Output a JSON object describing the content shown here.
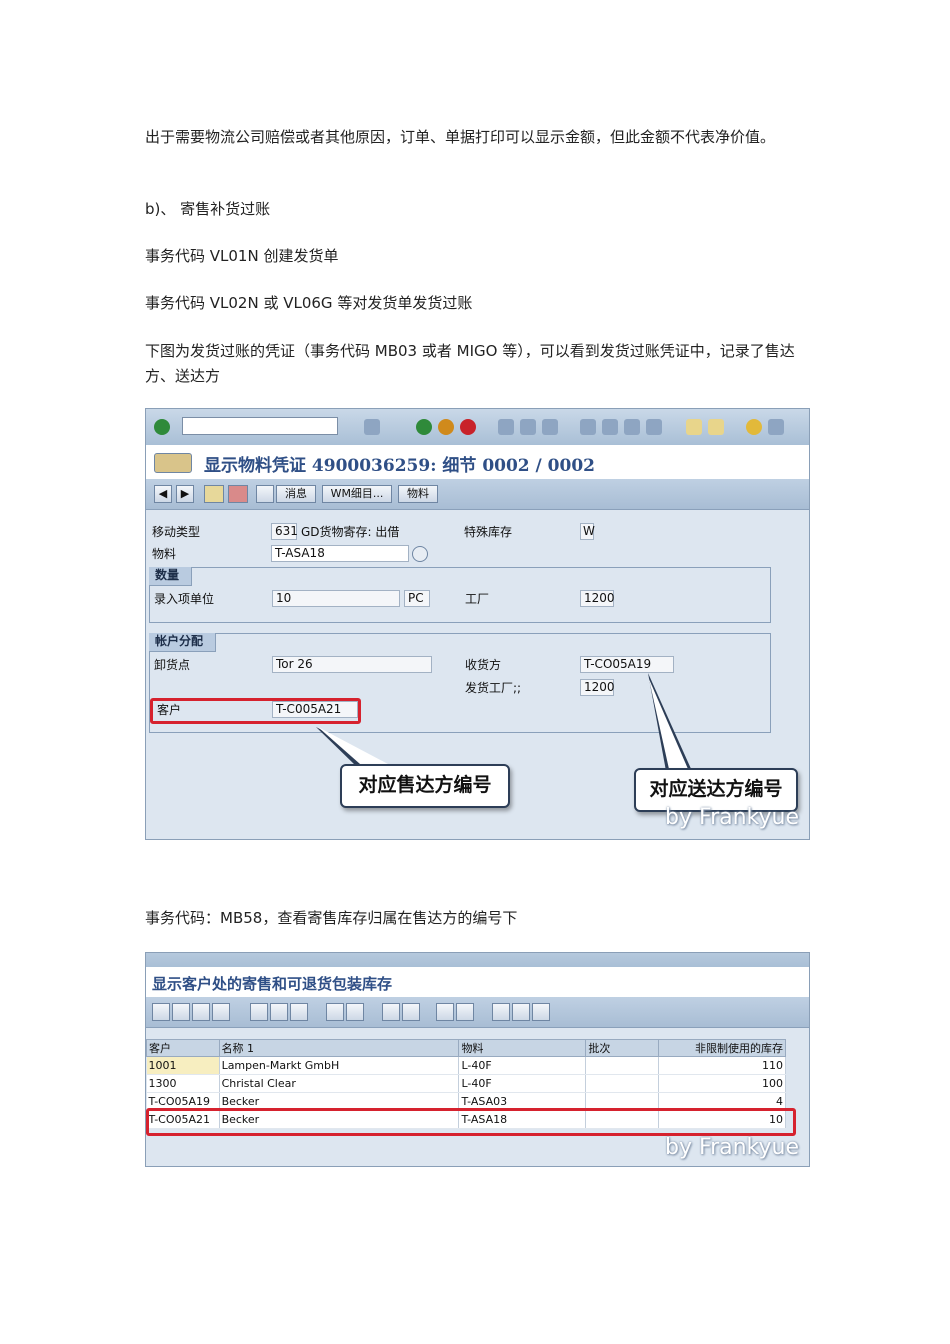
{
  "paragraphs": {
    "p1": "出于需要物流公司赔偿或者其他原因，订单、单据打印可以显示金额，但此金额不代表净价值。",
    "p2": "b)、   寄售补货过账",
    "p3": "事务代码 VL01N 创建发货单",
    "p4": "事务代码 VL02N 或 VL06G 等对发货单发货过账",
    "p5": "下图为发货过账的凭证（事务代码 MB03 或者 MIGO 等），可以看到发货过账凭证中，记录了售达方、送达方",
    "p6": "事务代码：MB58，查看寄售库存归属在售达方的编号下"
  },
  "screen1": {
    "title": "显示物料凭证 4900036259: 细节 0002 / 0002",
    "buttons": {
      "message": "消息",
      "wm_detail": "WM细目...",
      "material": "物料"
    },
    "fields": {
      "movement_type_label": "移动类型",
      "movement_type_value": "631",
      "movement_type_text": "GD货物寄存: 出借",
      "special_stock_label": "特殊库存",
      "special_stock_value": "W",
      "material_label": "物料",
      "material_value": "T-ASA18"
    },
    "quantity_group": {
      "title": "数量",
      "entry_unit_label": "录入项单位",
      "entry_unit_qty": "10",
      "entry_unit_uom": "PC",
      "plant_label": "工厂",
      "plant_value": "1200"
    },
    "account_group": {
      "title": "帐户分配",
      "unloading_point_label": "卸货点",
      "unloading_point_value": "Tor 26",
      "recipient_label": "收货方",
      "recipient_value": "T-CO05A19",
      "issuing_plant_label": "发货工厂;;",
      "issuing_plant_value": "1200",
      "customer_label": "客户",
      "customer_value": "T-C005A21"
    },
    "callouts": {
      "sold_to": "对应售达方编号",
      "ship_to": "对应送达方编号"
    },
    "watermark": "by Frankyue"
  },
  "screen2": {
    "title": "显示客户处的寄售和可退货包装库存",
    "columns": [
      "客户",
      "名称 1",
      "物料",
      "批次",
      "非限制使用的库存"
    ],
    "rows": [
      [
        "1001",
        "Lampen-Markt GmbH",
        "L-40F",
        "",
        "110"
      ],
      [
        "1300",
        "Christal Clear",
        "L-40F",
        "",
        "100"
      ],
      [
        "T-CO05A19",
        "Becker",
        "T-ASA03",
        "",
        "4"
      ],
      [
        "T-CO05A21",
        "Becker",
        "T-ASA18",
        "",
        "10"
      ]
    ],
    "watermark": "by Frankyue"
  },
  "colors": {
    "highlight_red": "#d6222e",
    "sap_blue": "#2f4f86",
    "panel_bg": "#dde6f0"
  },
  "icons": [
    "enter-icon",
    "back-icon",
    "exit-icon",
    "cancel-icon",
    "print-icon",
    "find-icon",
    "help-icon",
    "prev-item-icon",
    "next-item-icon"
  ]
}
